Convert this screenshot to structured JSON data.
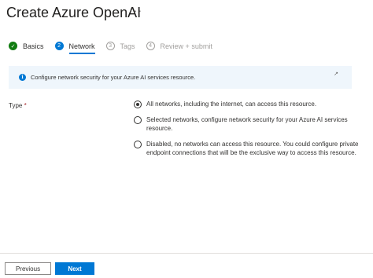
{
  "header": {
    "title": "Create Azure OpenAI",
    "more_label": "···"
  },
  "steps": [
    {
      "number": "✓",
      "label": "Basics",
      "state": "done"
    },
    {
      "number": "2",
      "label": "Network",
      "state": "active"
    },
    {
      "number": "3",
      "label": "Tags",
      "state": "todo"
    },
    {
      "number": "4",
      "label": "Review + submit",
      "state": "todo"
    }
  ],
  "info": {
    "icon": "i",
    "text": "Configure network security for your Azure AI services resource.",
    "link_icon": "↗"
  },
  "form": {
    "type_label": "Type",
    "required_marker": "*",
    "options": [
      {
        "text": "All networks, including the internet, can access this resource.",
        "checked": true
      },
      {
        "text": "Selected networks, configure network security for your Azure AI services resource.",
        "checked": false
      },
      {
        "text": "Disabled, no networks can access this resource. You could configure private endpoint connections that will be the exclusive way to access this resource.",
        "checked": false
      }
    ]
  },
  "footer": {
    "previous_label": "Previous",
    "next_label": "Next"
  },
  "colors": {
    "accent": "#0078d4",
    "success": "#107c10",
    "info_background": "#eff6fc"
  }
}
